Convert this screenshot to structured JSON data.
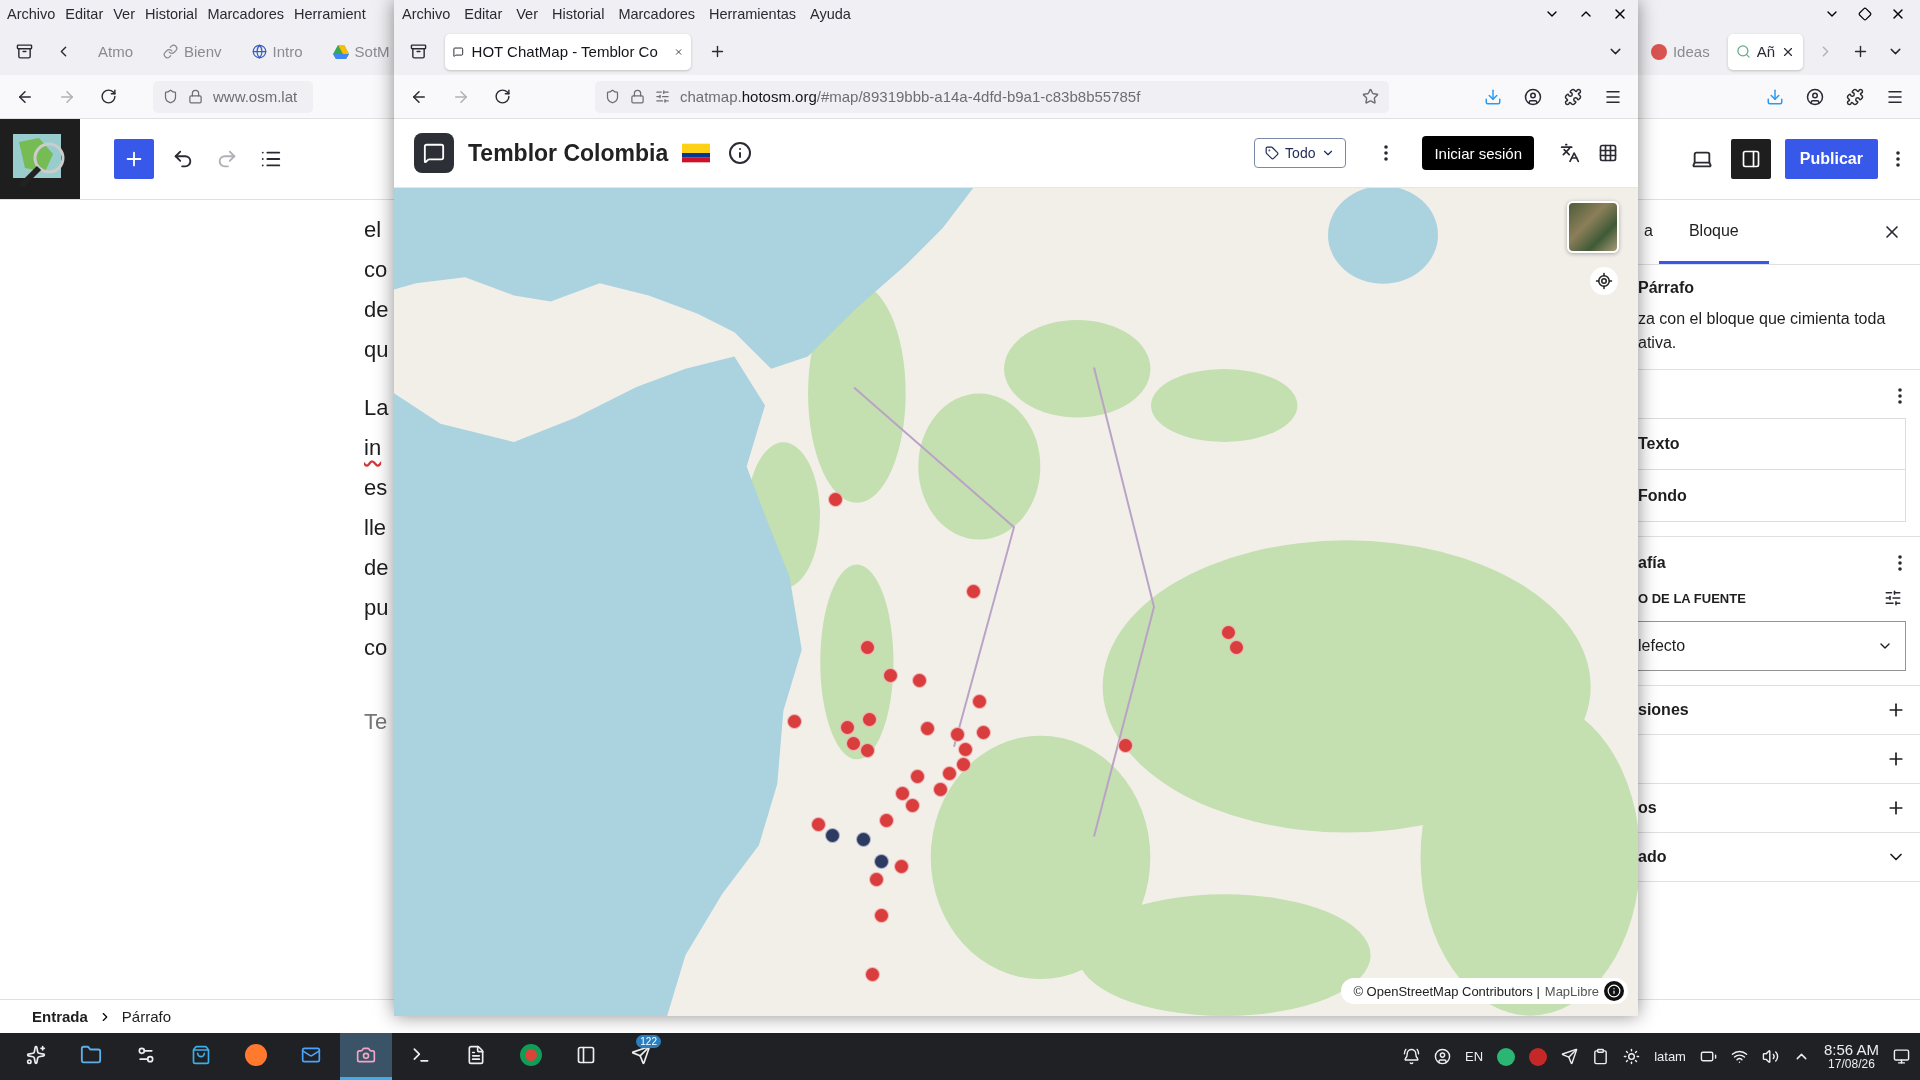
{
  "background_window": {
    "menu": [
      "Archivo",
      "Editar",
      "Ver",
      "Historial",
      "Marcadores",
      "Herramient"
    ],
    "tabs_left": [
      {
        "label": "Atmo",
        "kind": "plain",
        "selected": false
      },
      {
        "label": "Bienv",
        "kind": "link",
        "selected": false
      },
      {
        "label": "Intro",
        "kind": "globe",
        "selected": false
      },
      {
        "label": "SotM",
        "kind": "drive",
        "selected": false
      }
    ],
    "tabs_right": [
      {
        "label": "Ideas",
        "kind": "badge",
        "selected": false
      },
      {
        "label": "Añ",
        "kind": "map",
        "selected": true
      }
    ],
    "url": "www.osm.lat",
    "publish_button": "Publicar",
    "paragraphs": [
      {
        "lines": [
          {
            "text": "el",
            "misspelled": false
          },
          {
            "text": "co",
            "misspelled": false
          },
          {
            "text": "de",
            "misspelled": false
          },
          {
            "text": "qu",
            "misspelled": false
          }
        ]
      },
      {
        "lines": [
          {
            "text": "La",
            "misspelled": false
          },
          {
            "text": "in",
            "misspelled": true
          },
          {
            "text": "es",
            "misspelled": false
          },
          {
            "text": "lle",
            "misspelled": false
          },
          {
            "text": "de",
            "misspelled": false
          },
          {
            "text": "pu",
            "misspelled": false
          },
          {
            "text": "co",
            "misspelled": false
          }
        ]
      }
    ],
    "placeholder": "Te",
    "sidebar": {
      "tabs": [
        {
          "label": "a",
          "selected": false
        },
        {
          "label": "Bloque",
          "selected": true
        }
      ],
      "block_title": "Párrafo",
      "block_description": "za con el bloque que cimienta toda ativa.",
      "color_items": [
        "Texto",
        "Fondo"
      ],
      "typography_title": "afía",
      "font_label": "O DE LA FUENTE",
      "font_select": "lefecto",
      "sections": [
        {
          "label": "siones",
          "kind": "plus"
        },
        {
          "kind": "plus"
        },
        {
          "label": "os",
          "kind": "plus"
        },
        {
          "label": "ado",
          "kind": "chevron"
        }
      ]
    },
    "breadcrumb": [
      "Entrada",
      "Párrafo"
    ]
  },
  "window": {
    "menu": [
      "Archivo",
      "Editar",
      "Ver",
      "Historial",
      "Marcadores",
      "Herramientas",
      "Ayuda"
    ],
    "tabs": [
      {
        "title": "HOT ChatMap - Temblor Co",
        "selected": true
      }
    ],
    "url": {
      "subdomain": "chatmap.",
      "domain": "hotosm.org",
      "path": "/#map/89319bbb-a14a-4dfd-b9a1-c83b8b55785f"
    },
    "app": {
      "title": "Temblor Colombia",
      "filter": "Todo",
      "login_button": "Iniciar sesión",
      "attribution": "© OpenStreetMap Contributors |",
      "attribution_link": "MapLibre",
      "markers": [
        {
          "color": "#d93d3d"
        },
        {
          "color": "#d93d3d"
        },
        {
          "color": "#d93d3d"
        },
        {
          "color": "#d93d3d"
        },
        {
          "color": "#d93d3d"
        },
        {
          "color": "#d93d3d"
        },
        {
          "color": "#d93d3d"
        },
        {
          "color": "#d93d3d"
        },
        {
          "color": "#d93d3d"
        },
        {
          "color": "#d93d3d"
        },
        {
          "color": "#d93d3d"
        },
        {
          "color": "#d93d3d"
        },
        {
          "color": "#d93d3d"
        },
        {
          "color": "#d93d3d"
        },
        {
          "color": "#d93d3d"
        },
        {
          "color": "#d93d3d"
        },
        {
          "color": "#d93d3d"
        },
        {
          "color": "#d93d3d"
        },
        {
          "color": "#d93d3d"
        },
        {
          "color": "#d93d3d"
        },
        {
          "color": "#d93d3d"
        },
        {
          "color": "#d93d3d"
        },
        {
          "color": "#d93d3d"
        },
        {
          "color": "#d93d3d"
        },
        {
          "color": "#d93d3d"
        },
        {
          "color": "#d93d3d"
        },
        {
          "color": "#d93d3d"
        },
        {
          "color": "#d93d3d"
        },
        {
          "color": "#d93d3d"
        },
        {
          "color": "#d93d3d"
        },
        {
          "color": "#2d3b63"
        },
        {
          "color": "#2d3b63"
        },
        {
          "color": "#2d3b63"
        }
      ]
    }
  },
  "taskbar": {
    "apps": [
      {
        "kind": "launcher",
        "selected": false
      },
      {
        "kind": "files",
        "selected": false
      },
      {
        "kind": "settings",
        "selected": false
      },
      {
        "kind": "store",
        "selected": false
      },
      {
        "kind": "firefox",
        "selected": false
      },
      {
        "kind": "mail",
        "selected": false
      },
      {
        "kind": "screenshot",
        "selected": true
      },
      {
        "kind": "terminal",
        "selected": false
      },
      {
        "kind": "notes",
        "selected": false
      },
      {
        "kind": "chrome",
        "selected": false
      },
      {
        "kind": "sidebar",
        "selected": false
      },
      {
        "kind": "telegram",
        "selected": false,
        "badge": "122"
      }
    ],
    "language": "EN",
    "layout": "latam",
    "time": "8:56 AM",
    "date": "17/08/26"
  }
}
